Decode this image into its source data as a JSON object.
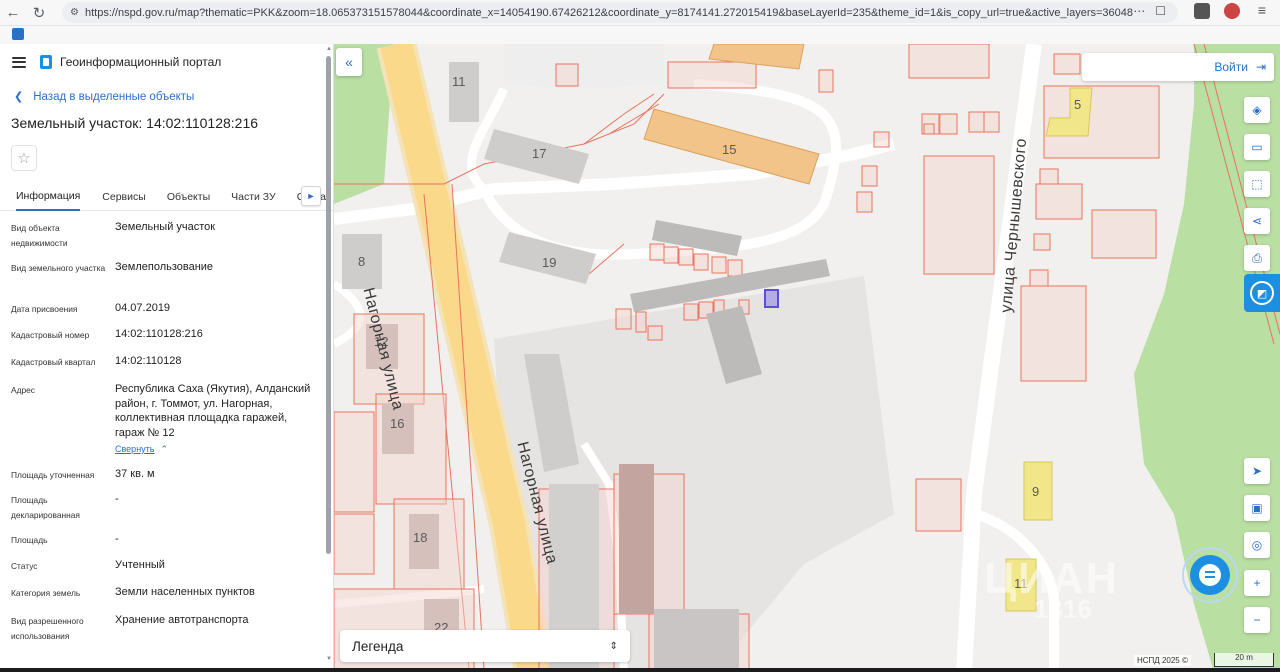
{
  "browser": {
    "url": "https://nspd.gov.ru/map?thematic=PKK&zoom=18.065373151578044&coordinate_x=14054190.67426212&coordinate_y=8174141.272015419&baseLayerId=235&theme_id=1&is_copy_url=true&active_layers=36048",
    "back_icon": "arrow-left-icon",
    "reload_icon": "reload-icon",
    "more_icon": "ellipsis-icon",
    "bookmark_icon": "bookmark-icon"
  },
  "sidebar": {
    "portal_title": "Геоинформационный портал",
    "back_link": "Назад в выделенные объекты",
    "object_title": "Земельный участок: 14:02:110128:216",
    "tabs": [
      {
        "label": "Информация",
        "active": true
      },
      {
        "label": "Сервисы",
        "active": false
      },
      {
        "label": "Объекты",
        "active": false
      },
      {
        "label": "Части ЗУ",
        "active": false
      },
      {
        "label": "Соста",
        "active": false
      }
    ],
    "properties": [
      {
        "label": "Вид объекта недвижимости",
        "value": "Земельный участок"
      },
      {
        "label": "Вид земельного участка",
        "value": "Землепользование"
      },
      {
        "label": "Дата присвоения",
        "value": "04.07.2019"
      },
      {
        "label": "Кадастровый номер",
        "value": "14:02:110128:216"
      },
      {
        "label": "Кадастровый квартал",
        "value": "14:02:110128"
      },
      {
        "label": "Адрес",
        "value": "Республика Саха (Якутия), Алданский район, г. Томмот, ул. Нагорная, коллективная площадка гаражей, гараж № 12",
        "collapse": "Свернуть"
      },
      {
        "label": "Площадь уточненная",
        "value": "37 кв. м"
      },
      {
        "label": "Площадь декларированная",
        "value": "-"
      },
      {
        "label": "Площадь",
        "value": "-"
      },
      {
        "label": "Статус",
        "value": "Учтенный"
      },
      {
        "label": "Категория земель",
        "value": "Земли населенных пунктов"
      },
      {
        "label": "Вид разрешенного использования",
        "value": "Хранение автотранспорта"
      }
    ]
  },
  "map": {
    "login_label": "Войти",
    "legend_label": "Легенда",
    "attribution": "НСПД 2025 ©",
    "scale_label": "20 m",
    "watermark_top": "ЦИАН",
    "watermark_bottom": "1316",
    "streets": {
      "nagornaya": "Нагорная улица",
      "chernyshevskogo": "улица Чернышевского"
    },
    "building_numbers": [
      "11",
      "17",
      "15",
      "5",
      "8",
      "19",
      "12",
      "16",
      "18",
      "22",
      "9",
      "11"
    ],
    "tools": [
      "layers-icon",
      "ruler-icon",
      "select-area-icon",
      "share-icon",
      "print-icon"
    ],
    "right_tools": [
      "locate-icon",
      "minimap-icon",
      "geolocation-icon",
      "zoom-in-icon",
      "zoom-out-icon"
    ],
    "colors": {
      "parcel_stroke": "#e8735e",
      "selected_parcel": "#5b4fd6",
      "building_orange": "#f2c48a",
      "building_yellow": "#f1e68a",
      "green_area": "#b9dfa3",
      "road": "#ffffff",
      "main_road": "#fbd98a",
      "accent": "#1c8fe0"
    }
  }
}
